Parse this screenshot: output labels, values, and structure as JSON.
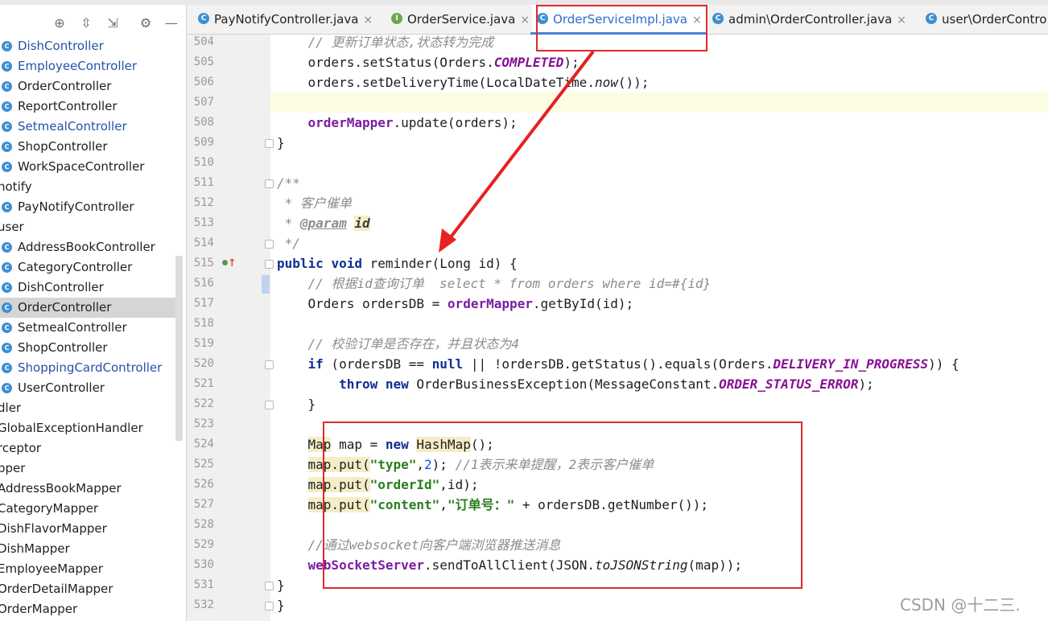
{
  "toolbar": {
    "icons": [
      "crosshair-icon",
      "expand-all-icon",
      "collapse-all-icon",
      "gear-icon",
      "minimize-icon"
    ],
    "glyphs": [
      "⊕",
      "⇳",
      "⇲",
      "⚙",
      "—"
    ]
  },
  "tree": [
    {
      "label": "DishController",
      "kind": "class",
      "modified": true
    },
    {
      "label": "EmployeeController",
      "kind": "class",
      "modified": true
    },
    {
      "label": "OrderController",
      "kind": "class",
      "modified": false
    },
    {
      "label": "ReportController",
      "kind": "class",
      "modified": false
    },
    {
      "label": "SetmealController",
      "kind": "class",
      "modified": true
    },
    {
      "label": "ShopController",
      "kind": "class",
      "modified": false
    },
    {
      "label": "WorkSpaceController",
      "kind": "class",
      "modified": false
    },
    {
      "label": "notify",
      "kind": "folder",
      "modified": false
    },
    {
      "label": "PayNotifyController",
      "kind": "class",
      "modified": false
    },
    {
      "label": "user",
      "kind": "folder",
      "modified": false
    },
    {
      "label": "AddressBookController",
      "kind": "class",
      "modified": false
    },
    {
      "label": "CategoryController",
      "kind": "class",
      "modified": false
    },
    {
      "label": "DishController",
      "kind": "class",
      "modified": false
    },
    {
      "label": "OrderController",
      "kind": "class",
      "modified": false,
      "selected": true
    },
    {
      "label": "SetmealController",
      "kind": "class",
      "modified": false
    },
    {
      "label": "ShopController",
      "kind": "class",
      "modified": false
    },
    {
      "label": "ShoppingCardController",
      "kind": "class",
      "modified": true
    },
    {
      "label": "UserController",
      "kind": "class",
      "modified": false
    },
    {
      "label": "dler",
      "kind": "folder",
      "modified": false
    },
    {
      "label": "GlobalExceptionHandler",
      "kind": "folder",
      "modified": false
    },
    {
      "label": "rceptor",
      "kind": "folder",
      "modified": false
    },
    {
      "label": "pper",
      "kind": "folder",
      "modified": false
    },
    {
      "label": "AddressBookMapper",
      "kind": "folder",
      "modified": false
    },
    {
      "label": "CategoryMapper",
      "kind": "folder",
      "modified": false
    },
    {
      "label": "DishFlavorMapper",
      "kind": "folder",
      "modified": false
    },
    {
      "label": "DishMapper",
      "kind": "folder",
      "modified": false
    },
    {
      "label": "EmployeeMapper",
      "kind": "folder",
      "modified": false
    },
    {
      "label": "OrderDetailMapper",
      "kind": "folder",
      "modified": false
    },
    {
      "label": "OrderMapper",
      "kind": "folder",
      "modified": false
    }
  ],
  "tabs": [
    {
      "label": "PayNotifyController.java",
      "icon": "C",
      "closable": true,
      "active": false
    },
    {
      "label": "OrderService.java",
      "icon": "I",
      "closable": true,
      "active": false
    },
    {
      "label": "OrderServiceImpl.java",
      "icon": "C",
      "closable": true,
      "active": true
    },
    {
      "label": "admin\\OrderController.java",
      "icon": "C",
      "closable": true,
      "active": false
    },
    {
      "label": "user\\OrderContro",
      "icon": "C",
      "closable": false,
      "active": false
    }
  ],
  "close_glyph": "×",
  "lines": [
    {
      "n": "504",
      "tokens": [
        [
          "cmt",
          "    // 更新订单状态,状态转为完成"
        ]
      ]
    },
    {
      "n": "505",
      "tokens": [
        [
          "",
          "    orders.setStatus(Orders."
        ],
        [
          "const",
          "COMPLETED"
        ],
        [
          "",
          ");"
        ]
      ]
    },
    {
      "n": "506",
      "tokens": [
        [
          "",
          "    orders.setDeliveryTime(LocalDateTime."
        ],
        [
          "ital",
          "now"
        ],
        [
          "",
          "());"
        ]
      ]
    },
    {
      "n": "507",
      "tokens": [],
      "current": true
    },
    {
      "n": "508",
      "tokens": [
        [
          "field",
          "    orderMapper"
        ],
        [
          "",
          ".update(orders);"
        ]
      ]
    },
    {
      "n": "509",
      "tokens": [
        [
          "",
          "}"
        ]
      ],
      "fold": true
    },
    {
      "n": "510",
      "tokens": []
    },
    {
      "n": "511",
      "tokens": [
        [
          "doc",
          "/**"
        ]
      ],
      "fold": true
    },
    {
      "n": "512",
      "tokens": [
        [
          "doc",
          " * 客户催单"
        ]
      ]
    },
    {
      "n": "513",
      "tokens": [
        [
          "doc",
          " * "
        ],
        [
          "doctag",
          "@param"
        ],
        [
          "doc",
          " "
        ],
        [
          "docparam",
          "id"
        ]
      ]
    },
    {
      "n": "514",
      "tokens": [
        [
          "doc",
          " */"
        ]
      ],
      "fold": true
    },
    {
      "n": "515",
      "tokens": [
        [
          "kw",
          "public"
        ],
        [
          "",
          " "
        ],
        [
          "kw",
          "void"
        ],
        [
          "",
          " reminder(Long id) {"
        ]
      ],
      "fold": true
    },
    {
      "n": "516",
      "tokens": [
        [
          "cmt",
          "    // 根据id查询订单  select * from orders where id=#{id}"
        ]
      ]
    },
    {
      "n": "517",
      "tokens": [
        [
          "",
          "    Orders ordersDB = "
        ],
        [
          "field",
          "orderMapper"
        ],
        [
          "",
          ".getById(id);"
        ]
      ]
    },
    {
      "n": "518",
      "tokens": []
    },
    {
      "n": "519",
      "tokens": [
        [
          "cmt",
          "    // 校验订单是否存在，并且状态为4"
        ]
      ]
    },
    {
      "n": "520",
      "tokens": [
        [
          "kw",
          "    if"
        ],
        [
          "",
          " (ordersDB == "
        ],
        [
          "kw",
          "null"
        ],
        [
          "",
          " || !ordersDB.getStatus().equals(Orders."
        ],
        [
          "const",
          "DELIVERY_IN_PROGRESS"
        ],
        [
          "",
          ")) {"
        ]
      ],
      "fold": true
    },
    {
      "n": "521",
      "tokens": [
        [
          "kw",
          "        throw"
        ],
        [
          "",
          " "
        ],
        [
          "kw",
          "new"
        ],
        [
          "",
          " OrderBusinessException(MessageConstant."
        ],
        [
          "const",
          "ORDER_STATUS_ERROR"
        ],
        [
          "",
          ");"
        ]
      ]
    },
    {
      "n": "522",
      "tokens": [
        [
          "",
          "    }"
        ]
      ],
      "fold": true
    },
    {
      "n": "523",
      "tokens": []
    },
    {
      "n": "524",
      "tokens": [
        [
          "",
          "    "
        ],
        [
          "hl",
          "Map"
        ],
        [
          "",
          " map = "
        ],
        [
          "kw",
          "new"
        ],
        [
          "",
          " "
        ],
        [
          "hl",
          "HashMap"
        ],
        [
          "",
          "();"
        ]
      ]
    },
    {
      "n": "525",
      "tokens": [
        [
          "",
          "    "
        ],
        [
          "hl",
          "map.put("
        ],
        [
          "str",
          "\"type\""
        ],
        [
          "",
          ","
        ],
        [
          "num",
          "2"
        ],
        [
          "",
          "); "
        ],
        [
          "cmt",
          "//1表示来单提醒，2表示客户催单"
        ]
      ]
    },
    {
      "n": "526",
      "tokens": [
        [
          "",
          "    "
        ],
        [
          "hl",
          "map.put("
        ],
        [
          "str",
          "\"orderId\""
        ],
        [
          "",
          ",id);"
        ]
      ]
    },
    {
      "n": "527",
      "tokens": [
        [
          "",
          "    "
        ],
        [
          "hl",
          "map.put("
        ],
        [
          "str",
          "\"content\""
        ],
        [
          "",
          ","
        ],
        [
          "str",
          "\"订单号：\""
        ],
        [
          "",
          " + ordersDB.getNumber());"
        ]
      ]
    },
    {
      "n": "528",
      "tokens": []
    },
    {
      "n": "529",
      "tokens": [
        [
          "cmt",
          "    //通过websocket向客户端浏览器推送消息"
        ]
      ]
    },
    {
      "n": "530",
      "tokens": [
        [
          "field",
          "    webSocketServer"
        ],
        [
          "",
          ".sendToAllClient(JSON."
        ],
        [
          "ital",
          "toJSONString"
        ],
        [
          "",
          "(map));"
        ]
      ]
    },
    {
      "n": "531",
      "tokens": [
        [
          "",
          "}"
        ]
      ],
      "fold": true
    },
    {
      "n": "532",
      "tokens": [
        [
          "",
          "}"
        ]
      ],
      "fold": true
    }
  ],
  "gutter_icon": "↑",
  "watermark": "CSDN @十二三.",
  "colors": {
    "annotation": "#dc2a2a",
    "active_tab": "#2a6dcc",
    "keyword": "#0e2e93",
    "string": "#2a7e1f",
    "constant": "#871094"
  }
}
